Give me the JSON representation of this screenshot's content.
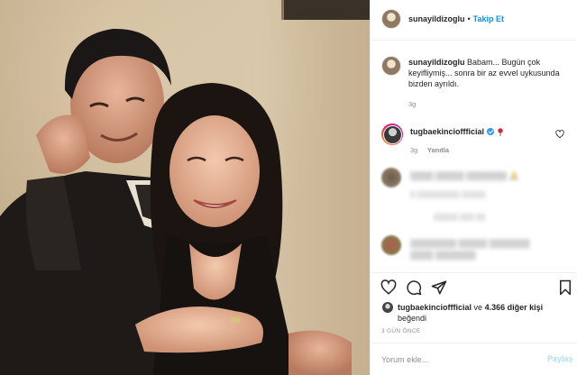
{
  "header": {
    "username": "sunayildizoglu",
    "separator": "•",
    "follow_label": "Takip Et"
  },
  "caption": {
    "username": "sunayildizoglu",
    "text": "Babam... Bugün çok keyifliymiş... sonra bir az evvel uykusunda bizden ayrıldı.",
    "time": "3g"
  },
  "comments": [
    {
      "username": "tugbaekincioffficial",
      "time": "3g",
      "action": "Yanıtla",
      "icon": "rose-icon",
      "verified": true
    },
    {
      "blurred_text": "▒▒▒▒ ▒▒▒▒▒ ▒▒▒▒▒▒▒ 🙏",
      "blurred_meta": "▒ ▒▒▒▒▒▒▒▒▒ ▒▒▒▒▒",
      "blurred_replies": "▒▒▒▒▒ ▒▒▒ ▒▒"
    },
    {
      "blurred_text": "▒▒▒▒▒▒▒▒ ▒▒▒▒▒ ▒▒▒▒▒▒▒",
      "blurred_text2": "▒▒▒▒ ▒▒▒▒▒▒▒"
    }
  ],
  "likes": {
    "liker": "tugbaekincioffficial",
    "connector": "ve",
    "count_text": "4.366 diğer kişi",
    "suffix": "beğendi"
  },
  "timestamp": "3 GÜN ÖNCE",
  "composer": {
    "placeholder": "Yorum ekle...",
    "post_label": "Paylaş"
  },
  "colors": {
    "accent": "#0095f6",
    "text": "#262626",
    "muted": "#8e8e8e"
  }
}
